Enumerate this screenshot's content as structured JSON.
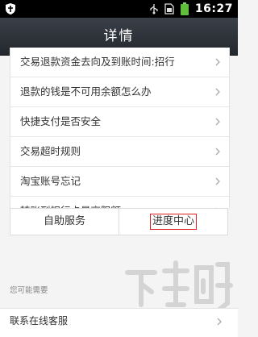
{
  "status_bar": {
    "time": "16:27",
    "icons": [
      "shield-icon",
      "usb-icon",
      "sim-icon",
      "battery-icon"
    ]
  },
  "header": {
    "title": "详情"
  },
  "list": {
    "items": [
      {
        "label": "交易退款资金去向及到账时间:招行"
      },
      {
        "label": "退款的钱是不可用余额怎么办"
      },
      {
        "label": "快捷支付是否安全"
      },
      {
        "label": "交易超时规则"
      },
      {
        "label": "淘宝账号忘记"
      },
      {
        "label": "转账到银行卡最高限额"
      }
    ]
  },
  "tabs": [
    {
      "label": "自助服务",
      "selected": false
    },
    {
      "label": "进度中心",
      "selected": true,
      "highlight_color": "#e02020"
    }
  ],
  "section": {
    "label": "您可能需要"
  },
  "bottom_item": {
    "label": "联系在线客服"
  },
  "colors": {
    "titlebar": "#2b3037",
    "highlight": "#e02020",
    "background": "#f4f4f4"
  }
}
